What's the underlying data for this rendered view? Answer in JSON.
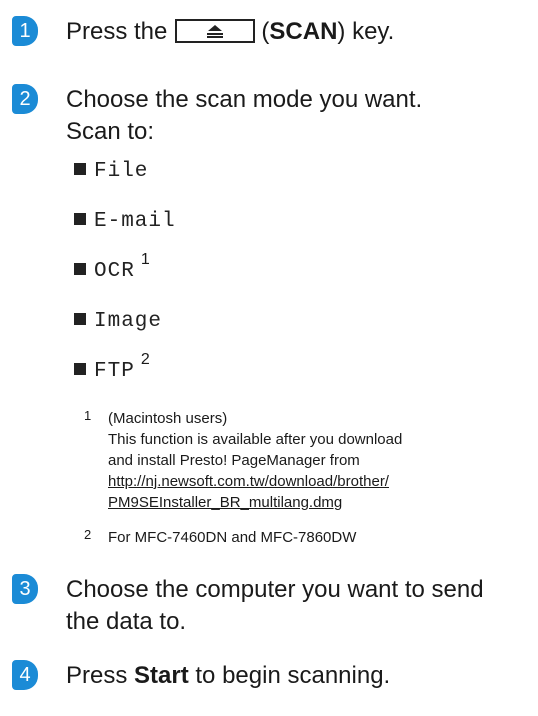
{
  "steps": [
    {
      "number": "1",
      "before": "Press the",
      "key_paren_open": "(",
      "key_label": "SCAN",
      "after": ") key."
    },
    {
      "number": "2",
      "line1": "Choose the scan mode you want.",
      "line2": "Scan to:"
    },
    {
      "number": "3",
      "line1": "Choose the computer you want to send",
      "line2": "the data to."
    },
    {
      "number": "4",
      "before": "Press",
      "bold": "Start",
      "after": "to begin scanning."
    }
  ],
  "options": [
    {
      "label": "File",
      "footnote": ""
    },
    {
      "label": "E-mail",
      "footnote": ""
    },
    {
      "label": "OCR",
      "footnote": "1"
    },
    {
      "label": "Image",
      "footnote": ""
    },
    {
      "label": "FTP",
      "footnote": "2"
    }
  ],
  "footnotes": [
    {
      "mark": "1",
      "line1": "(Macintosh users)",
      "line2": "This function is available after you download",
      "line3": "and install Presto! PageManager from",
      "link1": "http://nj.newsoft.com.tw/download/brother/",
      "link2": "PM9SEInstaller_BR_multilang.dmg"
    },
    {
      "mark": "2",
      "line1": "For MFC-7460DN and MFC-7860DW"
    }
  ],
  "colors": {
    "step_badge": "#1b8bd6"
  },
  "icons": {
    "scan_key": "scan-key-icon"
  }
}
